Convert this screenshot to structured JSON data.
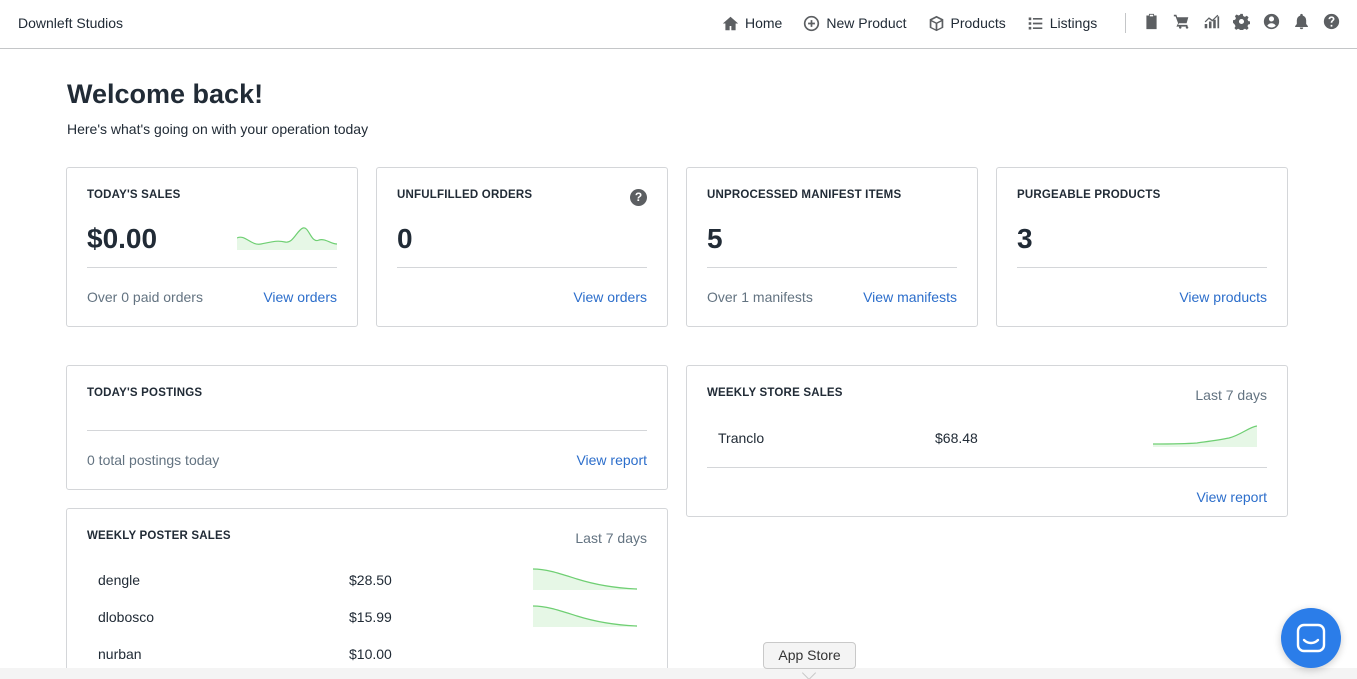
{
  "brand": "Downleft Studios",
  "nav": {
    "home": "Home",
    "new_product": "New Product",
    "products": "Products",
    "listings": "Listings"
  },
  "header": {
    "title": "Welcome back!",
    "subtitle": "Here's what's going on with your operation today"
  },
  "cards": {
    "todays_sales": {
      "title": "TODAY'S SALES",
      "value": "$0.00",
      "footer": "Over 0 paid orders",
      "link": "View orders"
    },
    "unfulfilled": {
      "title": "UNFULFILLED ORDERS",
      "value": "0",
      "link": "View orders",
      "help": "?"
    },
    "manifest": {
      "title": "UNPROCESSED MANIFEST ITEMS",
      "value": "5",
      "footer": "Over 1 manifests",
      "link": "View manifests"
    },
    "purgeable": {
      "title": "PURGEABLE PRODUCTS",
      "value": "3",
      "link": "View products"
    },
    "postings": {
      "title": "TODAY'S POSTINGS",
      "footer": "0 total postings today",
      "link": "View report"
    },
    "store_sales": {
      "title": "WEEKLY STORE SALES",
      "period": "Last 7 days",
      "rows": [
        {
          "name": "Tranclo",
          "value": "$68.48"
        }
      ],
      "link": "View report"
    },
    "poster_sales": {
      "title": "WEEKLY POSTER SALES",
      "period": "Last 7 days",
      "rows": [
        {
          "name": "dengle",
          "value": "$28.50"
        },
        {
          "name": "dlobosco",
          "value": "$15.99"
        },
        {
          "name": "nurban",
          "value": "$10.00"
        }
      ]
    }
  },
  "tooltip": "App Store",
  "colors": {
    "link": "#2c6ecb",
    "spark_line": "#6fcf73",
    "spark_fill": "#e6f7e6",
    "chat": "#2b7de9"
  }
}
